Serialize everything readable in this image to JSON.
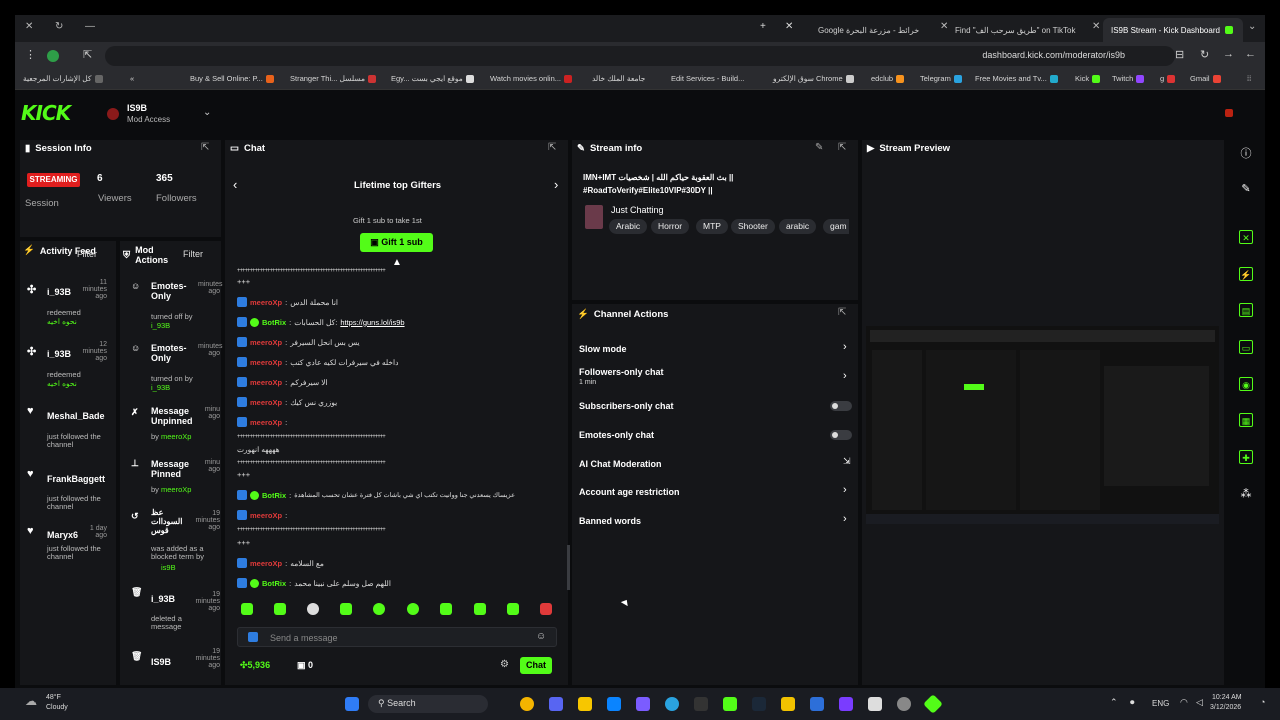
{
  "browser": {
    "tabs": [
      {
        "label": "Google خرائط - مزرعة البحرة",
        "active": false
      },
      {
        "label": "Find \"طريق سرحب الف\" on TikTok",
        "active": false
      },
      {
        "label": "IS9B Stream - Kick Dashboard",
        "active": true
      }
    ],
    "url": "dashboard.kick.com/moderator/is9b",
    "bookmarks": [
      "كل الإشارات المرجعية",
      "Buy & Sell Online: P...",
      "Stranger Thi... مسلسل",
      "Egy... موقع ايجي بست",
      "Watch movies onlin...",
      "جامعة الملك خالد",
      "Edit Services - Build...",
      "سوق الإلكترو Chrome",
      "edclub",
      "Telegram",
      "Free Movies and Tv...",
      "Kick",
      "Twitch",
      "g",
      "Gmail"
    ]
  },
  "kick": {
    "logo": "KICK",
    "channel": "IS9B",
    "role": "Mod Access"
  },
  "session": {
    "title": "Session Info",
    "status": "STREAMING",
    "viewers": "6",
    "followers": "365",
    "session_label": "Session",
    "viewers_label": "Viewers",
    "followers_label": "Followers"
  },
  "activity": {
    "title": "Activity Feed",
    "filter": "Filter",
    "items": [
      {
        "name": "i_93B",
        "sub": "redeemed",
        "extra": "نحوه اخيه",
        "time": "11 minutes ago"
      },
      {
        "name": "i_93B",
        "sub": "redeemed",
        "extra": "نحوه اخيه",
        "time": "12 minutes ago"
      },
      {
        "name": "Meshal_Bade",
        "sub": "just followed the channel",
        "time": ""
      },
      {
        "name": "FrankBaggett",
        "sub": "just followed the channel",
        "time": ""
      },
      {
        "name": "Maryx6",
        "sub": "just followed the channel",
        "time": "1 day ago"
      }
    ]
  },
  "mod_actions": {
    "title": "Mod Actions",
    "filter": "Filter",
    "items": [
      {
        "name": "Emotes-Only",
        "sub": "turned off by",
        "by": "i_93B",
        "time": "minutes ago"
      },
      {
        "name": "Emotes-Only",
        "sub": "turned on by",
        "by": "i_93B",
        "time": "minutes ago"
      },
      {
        "name": "Message Unpinned",
        "sub": "by",
        "by": "meeroXp",
        "time": "minu ago"
      },
      {
        "name": "Message Pinned",
        "sub": "by",
        "by": "meeroXp",
        "time": "minu ago"
      },
      {
        "name": "عظ السوداات قوس",
        "sub": "was added as a blocked term by",
        "by": "is9B",
        "time": "19 minutes ago"
      },
      {
        "name": "i_93B",
        "sub": "deleted a message",
        "by": "",
        "time": "19 minutes ago"
      },
      {
        "name": "IS9B",
        "sub": "",
        "by": "",
        "time": "19 minutes ago"
      }
    ]
  },
  "chat": {
    "title": "Chat",
    "gifters_title": "Lifetime top Gifters",
    "gift_hint": "Gift 1 sub to take 1st",
    "gift_button": "Gift 1 sub",
    "messages": [
      {
        "user": "meeroXp",
        "text": "انا محملة الدس",
        "bot": false
      },
      {
        "user": "BotRix",
        "text": "كل الحسابات:",
        "link": "https://guns.lol/is9b",
        "bot": true
      },
      {
        "user": "meeroXp",
        "text": "يس بس انحل السيرفر",
        "bot": false
      },
      {
        "user": "meeroXp",
        "text": "داخله في سيرفرات لكيه عادي كتب",
        "bot": false
      },
      {
        "user": "meeroXp",
        "text": "الا سيرفركم",
        "bot": false
      },
      {
        "user": "meeroXp",
        "text": "يوزري نس كيك",
        "bot": false
      },
      {
        "user": "meeroXp",
        "text": "",
        "bot": false
      },
      {
        "user": "BotRix",
        "text": "عزيساك يسعدني جنا ووانيت تكتب اي شي باشات كل فترة عشان تحسب المشاهدة",
        "bot": true
      },
      {
        "user": "meeroXp",
        "text": "",
        "bot": false
      },
      {
        "user": "meeroXp",
        "text": "مع السلامه",
        "bot": false
      },
      {
        "user": "BotRix",
        "text": "اللهم صل وسلم على نبينا محمد",
        "bot": true
      }
    ],
    "sep_text": "+++++++++++++++++++++++++++++++++++++++++++++++++++++++++++",
    "sep_trail": "+++",
    "placeholder": "Send a message",
    "points": "5,936",
    "count": "0",
    "send": "Chat"
  },
  "stream_info": {
    "title": "Stream info",
    "stream_title_line1": "IMN+IMT بث العقوبة حياكم الله | شخصيات ||",
    "stream_title_line2": "#RoadToVerify#Elite10VIP#30DY ||",
    "category": "Just Chatting",
    "tags": [
      "Arabic",
      "Horror",
      "MTP",
      "Shooter",
      "arabic",
      "gam"
    ]
  },
  "channel_actions": {
    "title": "Channel Actions",
    "items": [
      {
        "label": "Slow mode",
        "control": "arrow"
      },
      {
        "label": "Followers-only chat",
        "sub": "1 min",
        "control": "arrow"
      },
      {
        "label": "Subscribers-only chat",
        "control": "toggle"
      },
      {
        "label": "Emotes-only chat",
        "control": "toggle"
      },
      {
        "label": "AI Chat Moderation",
        "control": "external"
      },
      {
        "label": "Account age restriction",
        "control": "arrow"
      },
      {
        "label": "Banned words",
        "control": "arrow"
      }
    ]
  },
  "preview": {
    "title": "Stream Preview"
  },
  "taskbar": {
    "weather_temp": "48°F",
    "weather_desc": "Cloudy",
    "search": "Search",
    "lang": "ENG",
    "time": "10:24 AM",
    "date": "3/12/2026"
  },
  "colors": {
    "kick_green": "#53fc18",
    "streaming_red": "#e01e1e",
    "panel_bg": "#151619"
  }
}
